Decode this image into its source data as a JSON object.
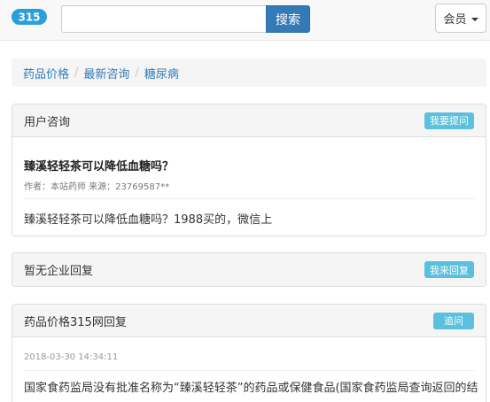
{
  "header": {
    "logo_text": "315",
    "search": {
      "value": "",
      "placeholder": ""
    },
    "search_button": "搜索",
    "member_button": "会员"
  },
  "breadcrumb": [
    "药品价格",
    "最新咨询",
    "糖尿病"
  ],
  "consult_panel": {
    "title": "用户咨询",
    "action": "我要提问",
    "question_title": "臻溪轻轻茶可以降低血糖吗？",
    "meta": "作者：本站药师 来源：23769587**",
    "body": "臻溪轻轻茶可以降低血糖吗？1988买的，微信上"
  },
  "company_panel": {
    "title": "暂无企业回复",
    "action": "我来回复"
  },
  "reply_panel": {
    "title": "药品价格315网回复",
    "action": "追问",
    "date": "2018-03-30 14:34:11",
    "text": "国家食药监局没有批准名称为“臻溪轻轻茶”的药品或保健食品(国家食药监局查询返回的结"
  },
  "colors": {
    "primary": "#337ab7",
    "info": "#5bc0de",
    "logo_blue": "#2a9fd8"
  }
}
